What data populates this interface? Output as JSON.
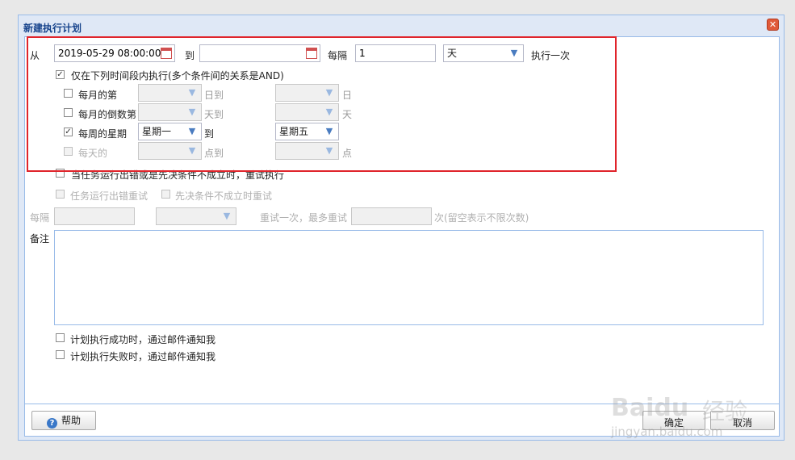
{
  "dialog": {
    "title": "新建执行计划",
    "close": "✕"
  },
  "schedule": {
    "from_label": "从",
    "from_value": "2019-05-29 08:00:00",
    "to_label": "到",
    "to_value": "",
    "every_label": "每隔",
    "every_value": "1",
    "unit_value": "天",
    "execute_once_label": "执行一次"
  },
  "range": {
    "only_within_label": "仅在下列时间段内执行(多个条件间的关系是AND)",
    "monthly_day_label": "每月的第",
    "monthly_day_to": "日到",
    "monthly_day_end": "日",
    "monthly_last_label": "每月的倒数第",
    "monthly_last_to": "天到",
    "monthly_last_end": "天",
    "weekly_label": "每周的星期",
    "weekly_from": "星期一",
    "weekly_to_label": "到",
    "weekly_to": "星期五",
    "daily_label": "每天的",
    "daily_to": "点到",
    "daily_end": "点"
  },
  "retry": {
    "on_fail_label": "当任务运行出错或是先决条件不成立时，重试执行",
    "task_error_label": "任务运行出错重试",
    "precondition_label": "先决条件不成立时重试",
    "every_label": "每隔",
    "retry_once_label": "重试一次，最多重试",
    "times_hint": "次(留空表示不限次数)"
  },
  "notes": {
    "label": "备注"
  },
  "notify": {
    "success_label": "计划执行成功时，通过邮件通知我",
    "failure_label": "计划执行失败时，通过邮件通知我"
  },
  "footer": {
    "help_label": "帮助",
    "ok_label": "确定",
    "cancel_label": "取消"
  },
  "watermark": {
    "brand": "Baidu",
    "product": "经验",
    "url": "jingyan.baidu.com"
  }
}
